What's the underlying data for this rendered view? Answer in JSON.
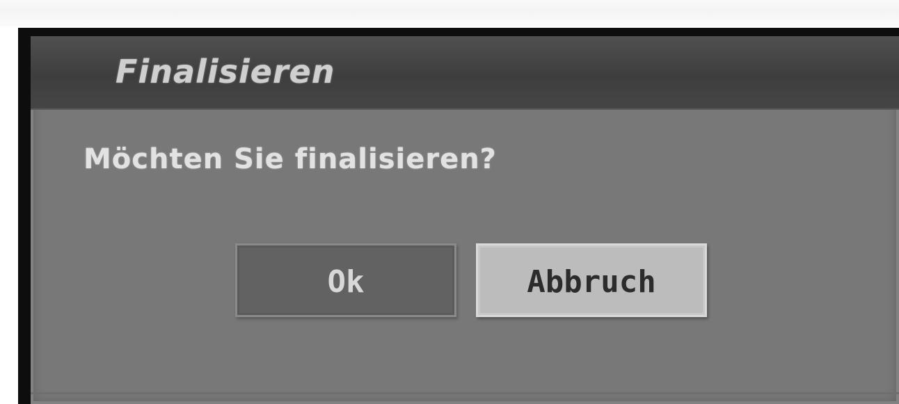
{
  "dialog": {
    "title": "Finalisieren",
    "message": "Möchten Sie finalisieren?",
    "buttons": {
      "ok_label": "Ok",
      "cancel_label": "Abbruch"
    },
    "selected_button": "cancel"
  }
}
